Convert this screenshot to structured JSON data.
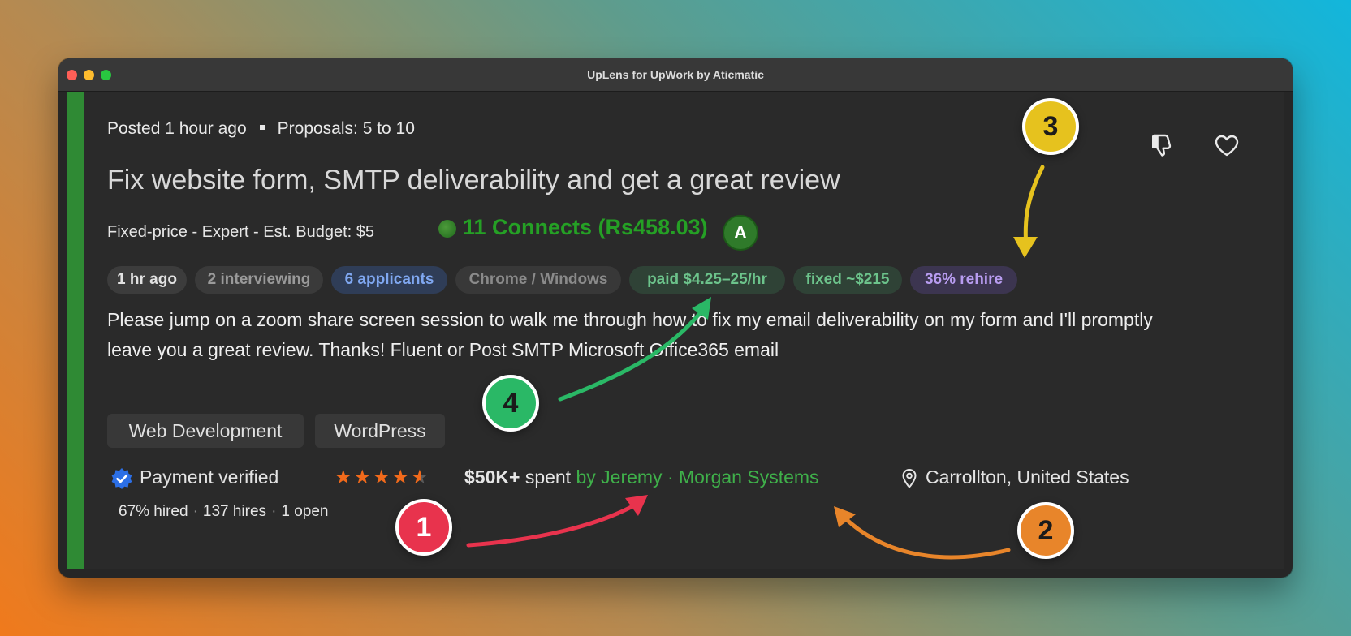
{
  "window": {
    "title": "UpLens for UpWork by Aticmatic"
  },
  "job": {
    "posted": "Posted 1 hour ago",
    "proposals": "Proposals: 5 to 10",
    "title": "Fix website form, SMTP deliverability and get a great review",
    "budget": "Fixed-price - Expert - Est. Budget: $5",
    "connects": "11 Connects (Rs458.03)",
    "a_badge": "A",
    "description": "Please jump on a zoom share screen session to walk me through how to fix my email deliverability on my form and I'll promptly leave you a great review. Thanks! Fluent or Post SMTP Microsoft Office365 email"
  },
  "chips": [
    {
      "label": "1 hr ago",
      "bg": "#3c3c3c",
      "color": "#e2e2e2"
    },
    {
      "label": "2 interviewing",
      "bg": "#3a3a3a",
      "color": "#9a9a9a"
    },
    {
      "label": "6 applicants",
      "bg": "#2f3d57",
      "color": "#7fa7f0"
    },
    {
      "label": "Chrome / Windows",
      "bg": "#383838",
      "color": "#8a8a8a"
    },
    {
      "label": "paid $4.25–25/hr",
      "bg": "#2f4236",
      "color": "#6cc38b"
    },
    {
      "label": "fixed ~$215",
      "bg": "#2f4236",
      "color": "#6cc38b"
    },
    {
      "label": "36% rehire",
      "bg": "#3c3550",
      "color": "#b89cf0"
    }
  ],
  "tags": [
    "Web Development",
    "WordPress"
  ],
  "client": {
    "payment": "Payment verified",
    "rating": 4.5,
    "stars": "★★★★",
    "half_star": "★",
    "spent_amount": "$50K+",
    "spent_label": "spent",
    "client_name": "by Jeremy · Morgan Systems",
    "location": "Carrollton, United States",
    "hired_pct": "67% hired",
    "hires": "137 hires",
    "open": "1 open",
    "stat_sep": "·"
  },
  "annotations": [
    {
      "label": "1",
      "color": "#e8334d"
    },
    {
      "label": "2",
      "color": "#e8852a"
    },
    {
      "label": "3",
      "color": "#e6c21e"
    },
    {
      "label": "4",
      "color": "#2ab866"
    }
  ],
  "icons": {
    "dislike": "thumbs-down-icon",
    "like": "heart-icon",
    "verified": "verified-badge-icon",
    "location": "map-pin-icon",
    "connects": "connects-coin-icon"
  }
}
